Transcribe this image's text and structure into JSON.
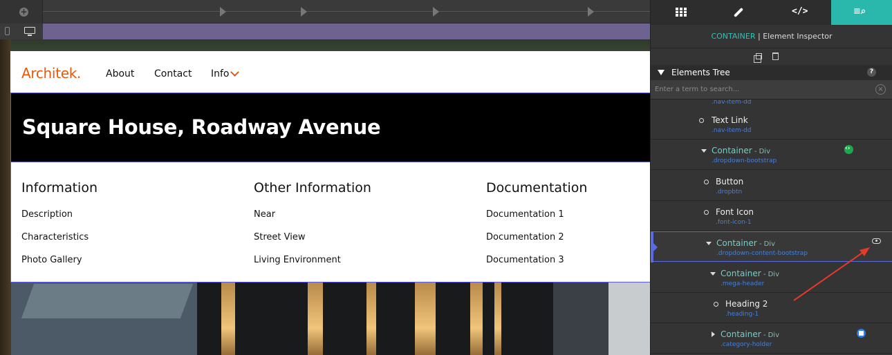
{
  "toolbar": {
    "add_icon": "plus-circle-icon",
    "devices": [
      "mobile",
      "desktop"
    ]
  },
  "site": {
    "logo": "Architek.",
    "nav": [
      "About",
      "Contact",
      "Info"
    ],
    "hero_title": "Square House, Roadway Avenue",
    "columns": [
      {
        "heading": "Information",
        "items": [
          "Description",
          "Characteristics",
          "Photo Gallery"
        ]
      },
      {
        "heading": "Other Information",
        "items": [
          "Near",
          "Street View",
          "Living Environment"
        ]
      },
      {
        "heading": "Documentation",
        "items": [
          "Documentation 1",
          "Documentation 2",
          "Documentation 3"
        ]
      }
    ]
  },
  "panel": {
    "header_accent": "CONTAINER",
    "header_sep": " | ",
    "header_title": "Element Inspector",
    "tree_label": "Elements Tree",
    "help": "?",
    "search_placeholder": "Enter a term to search...",
    "partial_class": ".nav-item-dd",
    "rows": [
      {
        "name": "Text Link",
        "type": "",
        "cls": ".nav-item-dd"
      },
      {
        "name": "Container",
        "type": " - Div",
        "cls": ".dropdown-bootstrap"
      },
      {
        "name": "Button",
        "type": "",
        "cls": ".dropbtn"
      },
      {
        "name": "Font Icon",
        "type": "",
        "cls": ".font-icon-1"
      },
      {
        "name": "Container",
        "type": " - Div",
        "cls": ".dropdown-content-bootstrap"
      },
      {
        "name": "Container",
        "type": " - Div",
        "cls": ".mega-header"
      },
      {
        "name": "Heading 2",
        "type": "",
        "cls": ".heading-1"
      },
      {
        "name": "Container",
        "type": " - Div",
        "cls": ".category-holder"
      }
    ]
  },
  "colors": {
    "accent": "#2bb8ac",
    "brand": "#e8590c",
    "selection": "#5a6ae0",
    "annotation": "#e53a2a"
  }
}
